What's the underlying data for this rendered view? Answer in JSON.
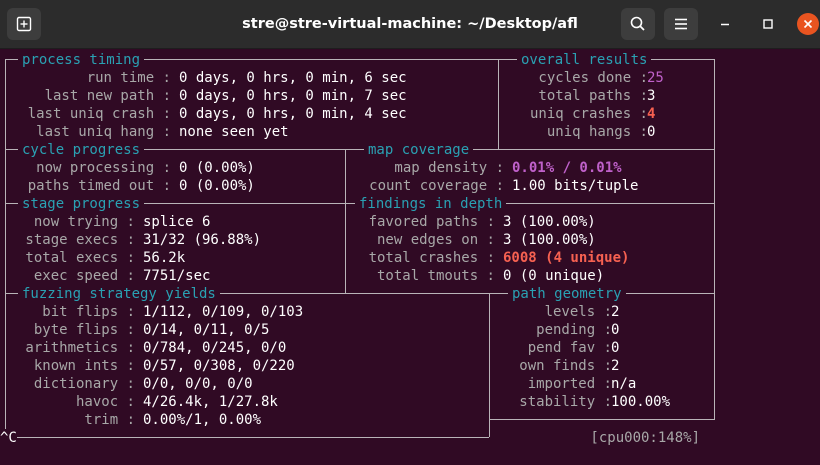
{
  "window": {
    "title": "stre@stre-virtual-machine: ~/Desktop/afl",
    "icons": [
      "new-tab-icon",
      "search-icon",
      "menu-icon",
      "minimize-icon",
      "maximize-icon",
      "close-icon"
    ]
  },
  "process_timing": {
    "header": "process timing",
    "rows": [
      {
        "label": "run time :",
        "value": "0 days, 0 hrs, 0 min, 6 sec"
      },
      {
        "label": "last new path :",
        "value": "0 days, 0 hrs, 0 min, 7 sec"
      },
      {
        "label": "last uniq crash :",
        "value": "0 days, 0 hrs, 0 min, 4 sec"
      },
      {
        "label": "last uniq hang :",
        "value": "none seen yet"
      }
    ]
  },
  "overall_results": {
    "header": "overall results",
    "rows": [
      {
        "label": "cycles done :",
        "value": "25"
      },
      {
        "label": "total paths :",
        "value": "3"
      },
      {
        "label": "uniq crashes :",
        "value": "4"
      },
      {
        "label": "uniq hangs :",
        "value": "0"
      }
    ]
  },
  "cycle_progress": {
    "header": "cycle progress",
    "rows": [
      {
        "label": "now processing :",
        "value": "0 (0.00%)"
      },
      {
        "label": "paths timed out :",
        "value": "0 (0.00%)"
      }
    ]
  },
  "map_coverage": {
    "header": "map coverage",
    "rows": [
      {
        "label": "map density :",
        "value": "0.01% / 0.01%"
      },
      {
        "label": "count coverage :",
        "value": "1.00 bits/tuple"
      }
    ]
  },
  "stage_progress": {
    "header": "stage progress",
    "rows": [
      {
        "label": "now trying :",
        "value": "splice 6"
      },
      {
        "label": "stage execs :",
        "value": "31/32 (96.88%)"
      },
      {
        "label": "total execs :",
        "value": "56.2k"
      },
      {
        "label": "exec speed :",
        "value": "7751/sec"
      }
    ]
  },
  "findings_in_depth": {
    "header": "findings in depth",
    "rows": [
      {
        "label": "favored paths :",
        "value": "3 (100.00%)"
      },
      {
        "label": "new edges on :",
        "value": "3 (100.00%)"
      },
      {
        "label": "total crashes :",
        "value": "6008 (4 unique)"
      },
      {
        "label": "total tmouts :",
        "value": "0 (0 unique)"
      }
    ]
  },
  "fuzzing_strategy_yields": {
    "header": "fuzzing strategy yields",
    "rows": [
      {
        "label": "bit flips :",
        "value": "1/112, 0/109, 0/103"
      },
      {
        "label": "byte flips :",
        "value": "0/14, 0/11, 0/5"
      },
      {
        "label": "arithmetics :",
        "value": "0/784, 0/245, 0/0"
      },
      {
        "label": "known ints :",
        "value": "0/57, 0/308, 0/220"
      },
      {
        "label": "dictionary :",
        "value": "0/0, 0/0, 0/0"
      },
      {
        "label": "havoc :",
        "value": "4/26.4k, 1/27.8k"
      },
      {
        "label": "trim :",
        "value": "0.00%/1, 0.00%"
      }
    ]
  },
  "path_geometry": {
    "header": "path geometry",
    "rows": [
      {
        "label": "levels :",
        "value": "2"
      },
      {
        "label": "pending :",
        "value": "0"
      },
      {
        "label": "pend fav :",
        "value": "0"
      },
      {
        "label": "own finds :",
        "value": "2"
      },
      {
        "label": "imported :",
        "value": "n/a"
      },
      {
        "label": "stability :",
        "value": "100.00%"
      }
    ]
  },
  "footer": {
    "interrupt": "^C",
    "cpu": "[cpu000:148%]"
  }
}
